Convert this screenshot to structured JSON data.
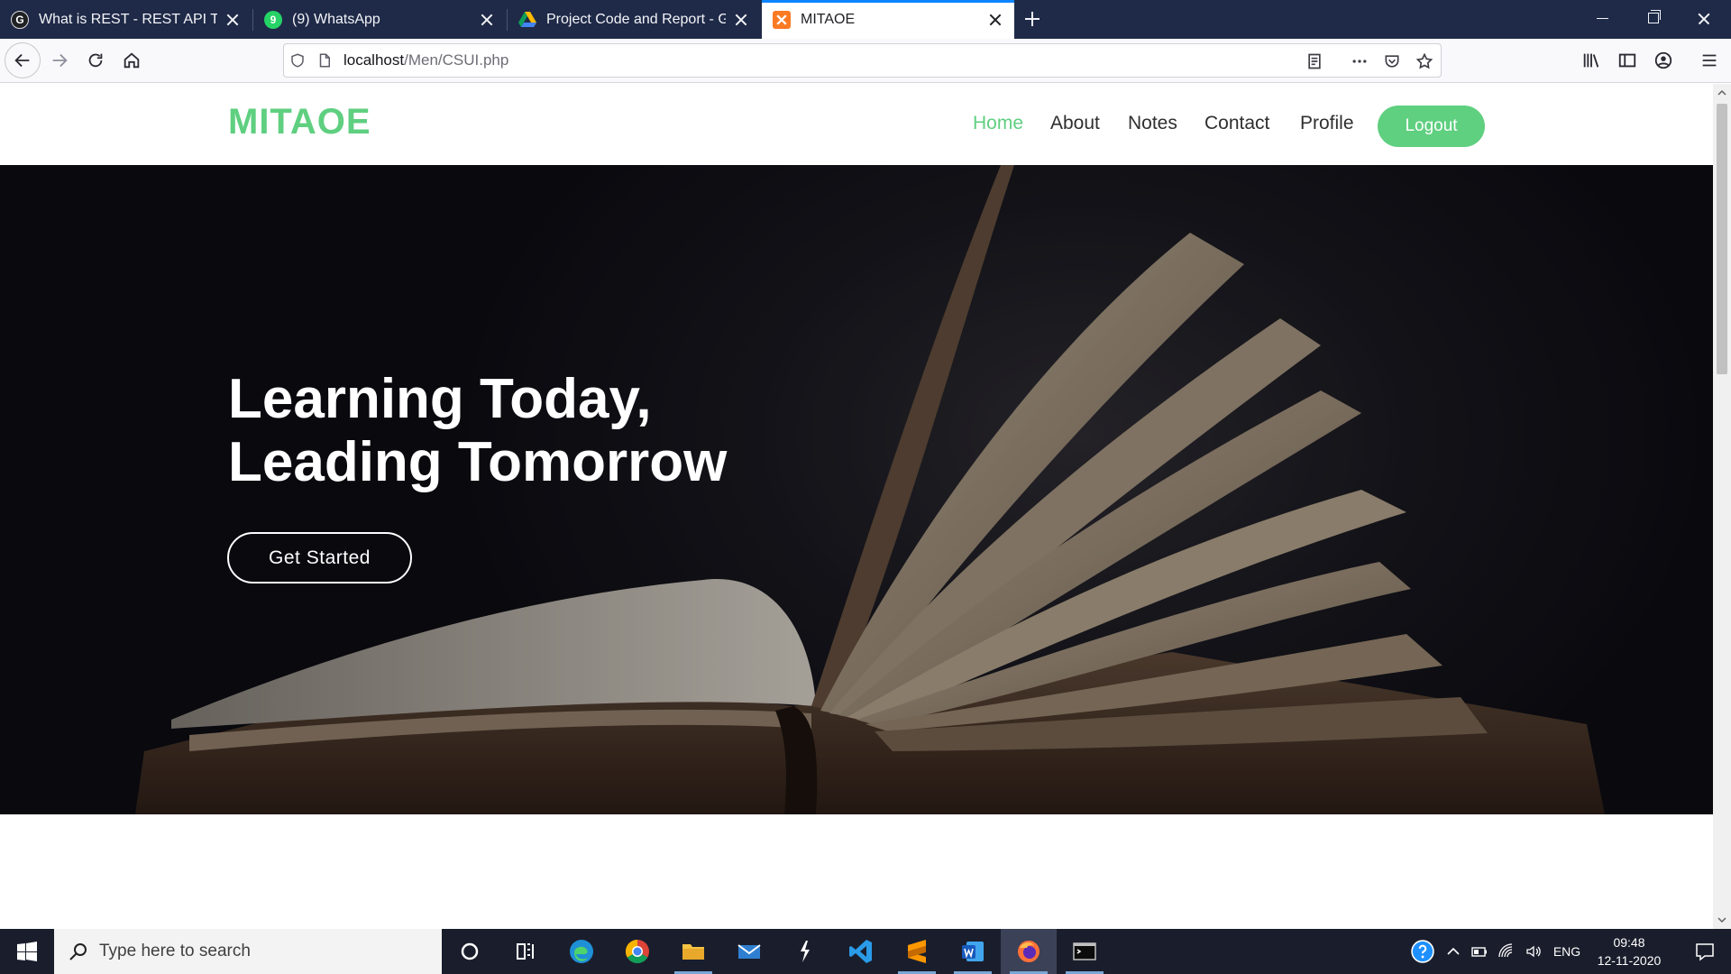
{
  "browser": {
    "tabs": [
      {
        "title": "What is REST - REST API Tutorial",
        "favicon": "letter-g-icon",
        "favicon_text": "G",
        "active": false
      },
      {
        "title": "(9) WhatsApp",
        "favicon": "whatsapp-icon",
        "favicon_text": "9",
        "active": false
      },
      {
        "title": "Project Code and Report - Google Drive",
        "favicon": "google-drive-icon",
        "favicon_text": "",
        "active": false
      },
      {
        "title": "MITAOE",
        "favicon": "xampp-icon",
        "favicon_text": "",
        "active": true
      }
    ],
    "url": {
      "host": "localhost",
      "path": "/Men/CSUI.php"
    }
  },
  "site": {
    "logo": "MITAOE",
    "nav": [
      {
        "label": "Home",
        "active": true
      },
      {
        "label": "About",
        "active": false
      },
      {
        "label": "Notes",
        "active": false
      },
      {
        "label": "Contact",
        "active": false
      },
      {
        "label": "Profile",
        "active": false
      }
    ],
    "logout_label": "Logout",
    "accent_color": "#5fcf80"
  },
  "hero": {
    "title_line1": "Learning Today,",
    "title_line2": "Leading Tomorrow",
    "cta_label": "Get Started",
    "background": "open book photograph"
  },
  "taskbar": {
    "search_placeholder": "Type here to search",
    "apps": [
      "cortana-icon",
      "task-view-icon",
      "edge-icon",
      "chrome-icon",
      "file-explorer-icon",
      "mail-icon",
      "git-bash-icon",
      "vscode-icon",
      "sublime-text-icon",
      "word-icon",
      "firefox-icon",
      "terminal-icon"
    ],
    "language": "ENG",
    "time": "09:48",
    "date": "12-11-2020"
  }
}
